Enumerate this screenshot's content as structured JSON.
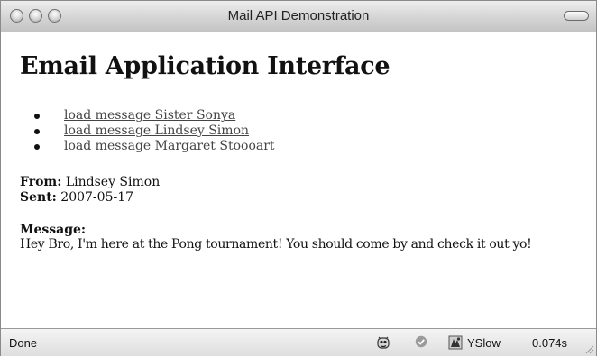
{
  "window": {
    "title": "Mail API Demonstration"
  },
  "page": {
    "heading": "Email Application Interface",
    "messages": [
      {
        "label": "load message Sister Sonya"
      },
      {
        "label": "load message Lindsey Simon"
      },
      {
        "label": "load message Margaret Stoooart"
      }
    ],
    "from_label": "From:",
    "from_value": "Lindsey Simon",
    "sent_label": "Sent:",
    "sent_value": "2007-05-17",
    "message_label": "Message:",
    "message_body": "Hey Bro, I'm here at the Pong tournament! You should come by and check it out yo!"
  },
  "statusbar": {
    "status": "Done",
    "yslow_label": "YSlow",
    "load_time": "0.074s",
    "icons": [
      "firebug-icon",
      "check-icon",
      "yslow-icon"
    ]
  },
  "colors": {
    "link": "#444444",
    "titlebar_top": "#ededed",
    "titlebar_bottom": "#c4c4c4"
  }
}
